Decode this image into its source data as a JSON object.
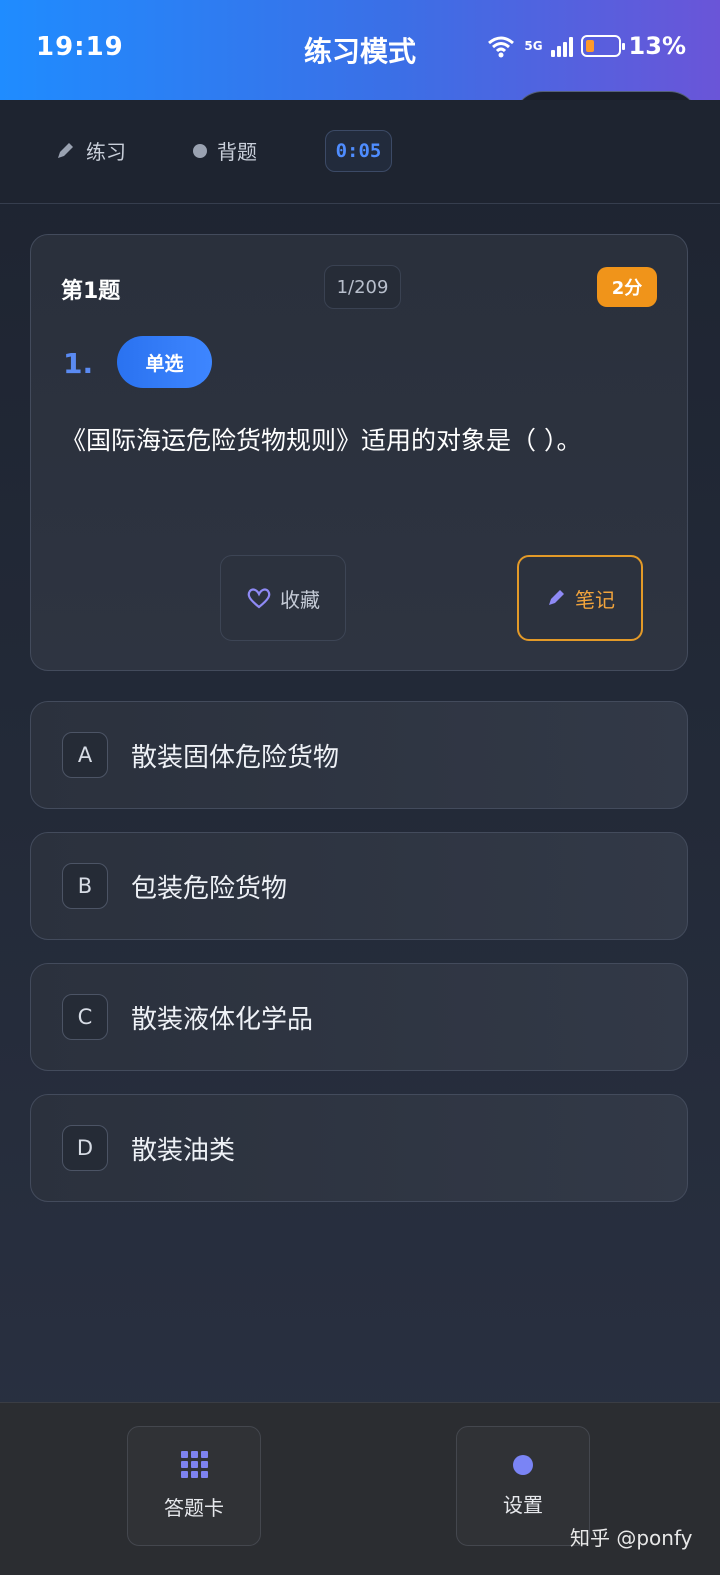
{
  "status_bar": {
    "time": "19:19",
    "network": "5G",
    "battery": "13%"
  },
  "header": {
    "title": "练习模式"
  },
  "mode_bar": {
    "practice_label": "练习",
    "recite_label": "背题",
    "timer": "0:05"
  },
  "question": {
    "label": "第1题",
    "progress": "1/209",
    "score": "2分",
    "index": "1.",
    "type": "单选",
    "text": "《国际海运危险货物规则》适用的对象是（ ）。",
    "favorite_label": "收藏",
    "note_label": "笔记"
  },
  "options": [
    {
      "letter": "A",
      "text": "散装固体危险货物"
    },
    {
      "letter": "B",
      "text": "包装危险货物"
    },
    {
      "letter": "C",
      "text": "散装液体化学品"
    },
    {
      "letter": "D",
      "text": "散装油类"
    }
  ],
  "bottom_bar": {
    "answer_card_label": "答题卡",
    "settings_label": "设置"
  },
  "watermark": "知乎 @ponfy",
  "colors": {
    "accent_blue": "#2a72f0",
    "score_orange": "#f0941a",
    "note_orange": "#e39a28",
    "icon_purple": "#7d82f0"
  }
}
